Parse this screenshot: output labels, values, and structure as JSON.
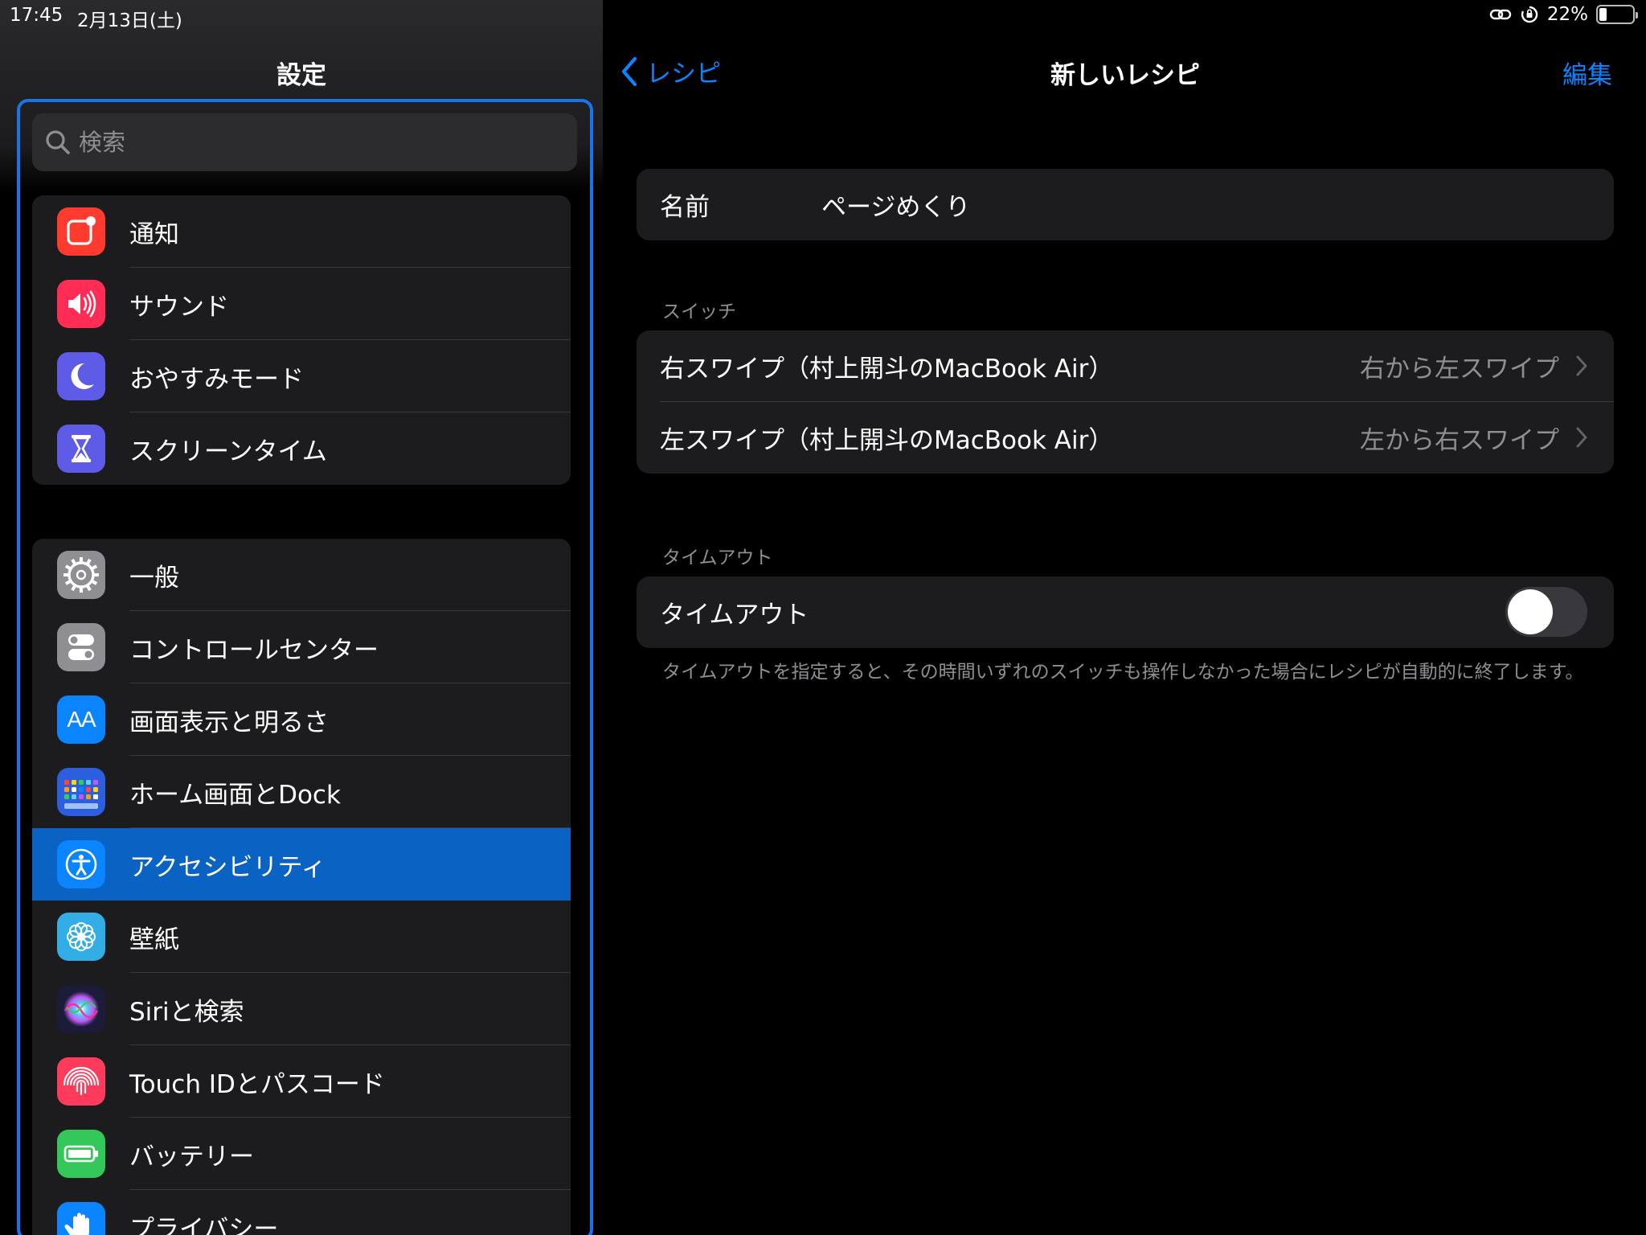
{
  "status_bar": {
    "time": "17:45",
    "date": "2月13日(土)",
    "battery_text": "22%",
    "battery_level": 0.22
  },
  "sidebar": {
    "title": "設定",
    "search_placeholder": "検索",
    "group1": [
      {
        "label": "通知",
        "icon": "notifications-icon",
        "color": "#ff3b30"
      },
      {
        "label": "サウンド",
        "icon": "sound-icon",
        "color": "#ff2d55"
      },
      {
        "label": "おやすみモード",
        "icon": "moon-icon",
        "color": "#5e5ce6"
      },
      {
        "label": "スクリーンタイム",
        "icon": "hourglass-icon",
        "color": "#5e5ce6"
      }
    ],
    "group2": [
      {
        "label": "一般",
        "icon": "gear-icon",
        "color": "#8e8e93"
      },
      {
        "label": "コントロールセンター",
        "icon": "toggles-icon",
        "color": "#8e8e93"
      },
      {
        "label": "画面表示と明るさ",
        "icon": "text-size-icon",
        "icon_text": "AA",
        "color": "#0a84ff"
      },
      {
        "label": "ホーム画面とDock",
        "icon": "home-grid-icon",
        "color": "#2c5fe0"
      },
      {
        "label": "アクセシビリティ",
        "icon": "accessibility-icon",
        "color": "#0a84ff",
        "selected": true
      },
      {
        "label": "壁紙",
        "icon": "flower-icon",
        "color": "#32ade6"
      },
      {
        "label": "Siriと検索",
        "icon": "siri-icon",
        "color": "#1c1c3a"
      },
      {
        "label": "Touch IDとパスコード",
        "icon": "fingerprint-icon",
        "color": "#ff3b5c"
      },
      {
        "label": "バッテリー",
        "icon": "battery-icon",
        "color": "#34c759"
      },
      {
        "label": "プライバシー",
        "icon": "hand-icon",
        "color": "#0a84ff"
      }
    ]
  },
  "detail": {
    "back_label": "レシピ",
    "title": "新しいレシピ",
    "edit_label": "編集",
    "name_label": "名前",
    "name_value": "ページめくり",
    "switch_section": "スイッチ",
    "switches": [
      {
        "name": "右スワイプ（村上開斗のMacBook Air）",
        "value": "右から左スワイプ"
      },
      {
        "name": "左スワイプ（村上開斗のMacBook Air）",
        "value": "左から右スワイプ"
      }
    ],
    "timeout_section": "タイムアウト",
    "timeout_label": "タイムアウト",
    "timeout_on": false,
    "timeout_footnote": "タイムアウトを指定すると、その時間いずれのスイッチも操作しなかった場合にレシピが自動的に終了します。"
  }
}
